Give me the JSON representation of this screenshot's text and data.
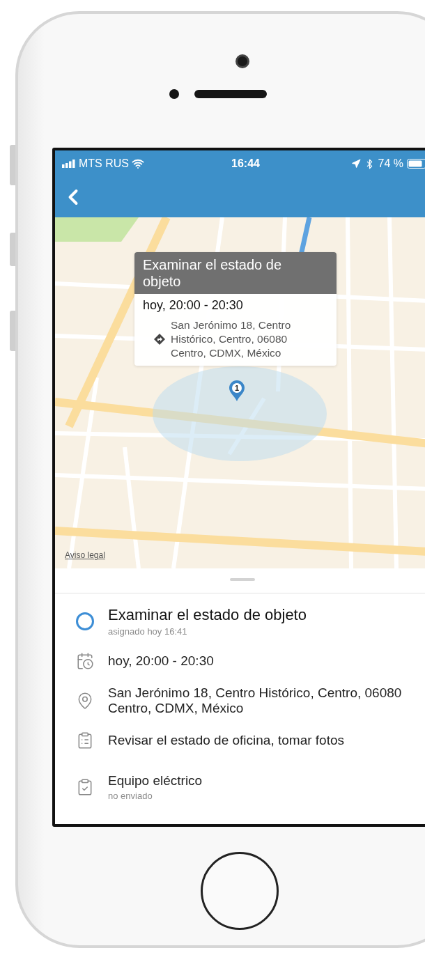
{
  "status_bar": {
    "carrier": "MTS RUS",
    "time": "16:44",
    "battery": "74 %"
  },
  "map": {
    "callout": {
      "title": "Examinar el estado de objeto",
      "time": "hoy, 20:00 - 20:30",
      "address": "San Jerónimo 18, Centro Histórico, Centro, 06080 Centro, CDMX, México"
    },
    "pin": {
      "label": "1"
    },
    "legal_link": "Aviso legal"
  },
  "task": {
    "title": "Examinar el estado de objeto",
    "subtitle": "asignado hoy 16:41",
    "done": false
  },
  "details": [
    {
      "kind": "time",
      "text": "hoy, 20:00 - 20:30"
    },
    {
      "kind": "address",
      "text": "San Jerónimo 18, Centro Histórico, Centro, 06080 Centro, CDMX, México"
    },
    {
      "kind": "note",
      "text": "Revisar el estado de oficina, tomar fotos"
    },
    {
      "kind": "checklist",
      "text": "Equipo eléctrico",
      "subtitle": "no enviado"
    }
  ]
}
